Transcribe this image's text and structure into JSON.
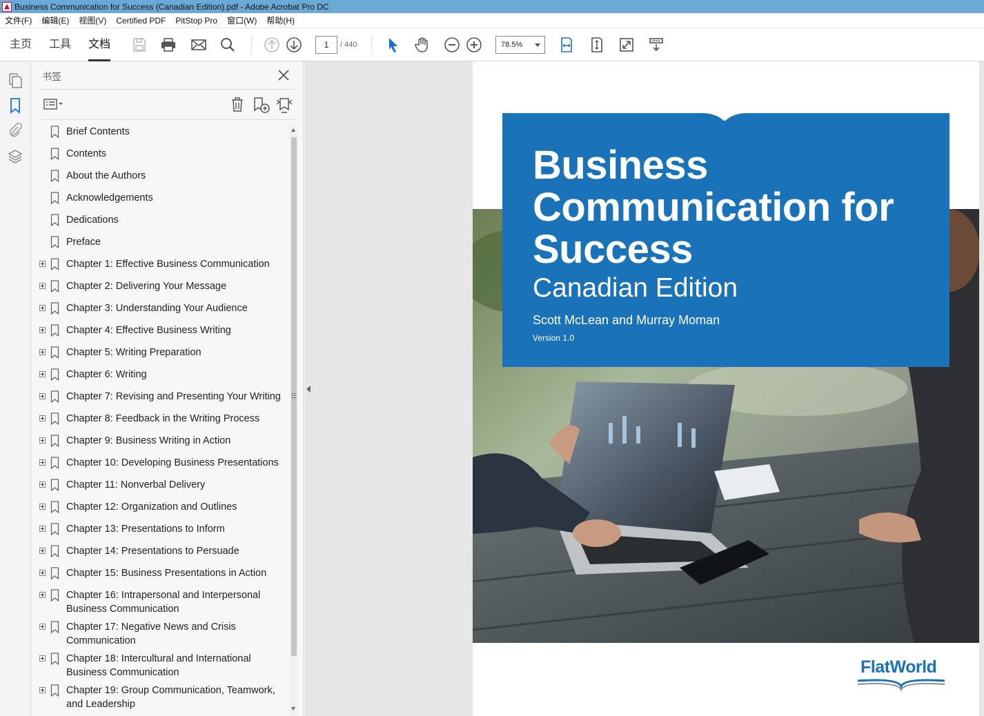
{
  "window": {
    "title": "Business Communication for Success (Canadian Edition).pdf - Adobe Acrobat Pro DC"
  },
  "menubar": {
    "items": [
      "文件(F)",
      "编辑(E)",
      "视图(V)",
      "Certified PDF",
      "PitStop Pro",
      "窗口(W)",
      "帮助(H)"
    ]
  },
  "toolbar": {
    "tabs": [
      "主页",
      "工具",
      "文档"
    ],
    "active_tab": "文档",
    "current_page": "1",
    "total_pages": "/ 440",
    "zoom": "78.5%"
  },
  "bookmarks": {
    "header": "书签",
    "items": [
      {
        "label": "Brief Contents",
        "expandable": false
      },
      {
        "label": "Contents",
        "expandable": false
      },
      {
        "label": "About the Authors",
        "expandable": false
      },
      {
        "label": "Acknowledgements",
        "expandable": false
      },
      {
        "label": "Dedications",
        "expandable": false
      },
      {
        "label": "Preface",
        "expandable": false
      },
      {
        "label": "Chapter 1: Effective Business Communication",
        "expandable": true
      },
      {
        "label": "Chapter 2: Delivering Your Message",
        "expandable": true
      },
      {
        "label": "Chapter 3: Understanding Your Audience",
        "expandable": true
      },
      {
        "label": "Chapter 4: Effective Business Writing",
        "expandable": true
      },
      {
        "label": "Chapter 5: Writing Preparation",
        "expandable": true
      },
      {
        "label": "Chapter 6: Writing",
        "expandable": true
      },
      {
        "label": "Chapter 7: Revising and Presenting Your Writing",
        "expandable": true
      },
      {
        "label": "Chapter 8: Feedback in the Writing Process",
        "expandable": true
      },
      {
        "label": "Chapter 9: Business Writing in Action",
        "expandable": true
      },
      {
        "label": "Chapter 10: Developing Business Presentations",
        "expandable": true
      },
      {
        "label": "Chapter 11: Nonverbal Delivery",
        "expandable": true
      },
      {
        "label": "Chapter 12: Organization and Outlines",
        "expandable": true
      },
      {
        "label": "Chapter 13: Presentations to Inform",
        "expandable": true
      },
      {
        "label": "Chapter 14: Presentations to Persuade",
        "expandable": true
      },
      {
        "label": "Chapter 15: Business Presentations in Action",
        "expandable": true
      },
      {
        "label": "Chapter 16: Intrapersonal and Interpersonal Business Communication",
        "expandable": true
      },
      {
        "label": "Chapter 17: Negative News and Crisis Communication",
        "expandable": true
      },
      {
        "label": "Chapter 18: Intercultural and International Business Communication",
        "expandable": true
      },
      {
        "label": "Chapter 19: Group Communication, Teamwork, and Leadership",
        "expandable": true
      }
    ]
  },
  "cover": {
    "title": "Business Communication for Success",
    "edition": "Canadian Edition",
    "authors": "Scott McLean and Murray Moman",
    "version": "Version 1.0",
    "publisher_logo": "FlatWorld",
    "brand_color": "#1a72b9"
  },
  "colors": {
    "titlebar": "#6aa9d6",
    "accent_blue": "#1a72b9",
    "panel_bg": "#f7f7f7"
  }
}
